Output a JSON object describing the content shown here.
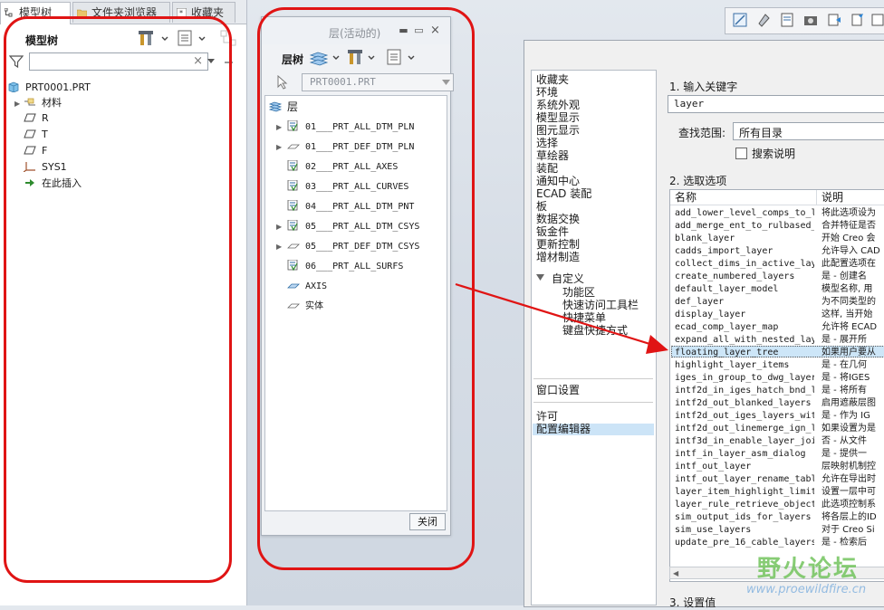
{
  "left_panel": {
    "tabs": [
      "模型树",
      "文件夹浏览器",
      "收藏夹"
    ],
    "title": "模型树",
    "filter_clear": "×",
    "tree": [
      {
        "label": "PRT0001.PRT",
        "icon": "part-icon",
        "level": 0,
        "expander": ""
      },
      {
        "label": "材料",
        "icon": "material-icon",
        "level": 1,
        "expander": "▶"
      },
      {
        "label": "R",
        "icon": "datum-plane-icon",
        "level": 1,
        "expander": ""
      },
      {
        "label": "T",
        "icon": "datum-plane-icon",
        "level": 1,
        "expander": ""
      },
      {
        "label": "F",
        "icon": "datum-plane-icon",
        "level": 1,
        "expander": ""
      },
      {
        "label": "SYS1",
        "icon": "csys-icon",
        "level": 1,
        "expander": ""
      },
      {
        "label": "在此插入",
        "icon": "insert-here-arrow-icon",
        "level": 1,
        "expander": ""
      }
    ]
  },
  "layer_window": {
    "title": "层(活动的)",
    "tree_label": "层树",
    "model_select": "PRT0001.PRT",
    "root": "层",
    "layers": [
      {
        "label": "01___PRT_ALL_DTM_PLN",
        "expander": "▶",
        "icon": "layer-rule-icon"
      },
      {
        "label": "01___PRT_DEF_DTM_PLN",
        "expander": "▶",
        "icon": "layer-plane-icon"
      },
      {
        "label": "02___PRT_ALL_AXES",
        "expander": "",
        "icon": "layer-rule-icon"
      },
      {
        "label": "03___PRT_ALL_CURVES",
        "expander": "",
        "icon": "layer-rule-icon"
      },
      {
        "label": "04___PRT_ALL_DTM_PNT",
        "expander": "",
        "icon": "layer-rule-icon"
      },
      {
        "label": "05___PRT_ALL_DTM_CSYS",
        "expander": "▶",
        "icon": "layer-rule-icon"
      },
      {
        "label": "05___PRT_DEF_DTM_CSYS",
        "expander": "▶",
        "icon": "layer-plane-icon"
      },
      {
        "label": "06___PRT_ALL_SURFS",
        "expander": "",
        "icon": "layer-rule-icon"
      },
      {
        "label": "AXIS",
        "expander": "",
        "icon": "layer-plane-blue-icon"
      },
      {
        "label": "实体",
        "expander": "",
        "icon": "layer-plane-icon"
      }
    ],
    "close_label": "关闭"
  },
  "options_dialog": {
    "nav": [
      "收藏夹",
      "环境",
      "系统外观",
      "模型显示",
      "图元显示",
      "选择",
      "草绘器",
      "装配",
      "通知中心",
      "ECAD 装配",
      "板",
      "数据交换",
      "钣金件",
      "更新控制",
      "增材制造"
    ],
    "customize": {
      "label": "自定义",
      "children": [
        "功能区",
        "快速访问工具栏",
        "快捷菜单",
        "键盘快捷方式"
      ]
    },
    "window_settings": "窗口设置",
    "license": "许可",
    "config_editor": "配置编辑器",
    "step1": "1.  输入关键字",
    "keyword": "layer",
    "scope_label": "查找范围:",
    "scope_value": "所有目录",
    "search_desc": "搜索说明",
    "step2": "2.  选取选项",
    "col_name": "名称",
    "col_desc": "说明",
    "options": [
      {
        "name": "add_lower_level_comps_to_l",
        "desc": "将此选项设为"
      },
      {
        "name": "add_merge_ent_to_rulbased_",
        "desc": "合并特征是否"
      },
      {
        "name": "blank_layer",
        "desc": "开始 Creo 会"
      },
      {
        "name": "cadds_import_layer",
        "desc": "允许导入 CAD"
      },
      {
        "name": "collect_dims_in_active_lay",
        "desc": "此配置选项在"
      },
      {
        "name": "create_numbered_layers",
        "desc": "是 - 创建名"
      },
      {
        "name": "default_layer_model",
        "desc": "模型名称, 用"
      },
      {
        "name": "def_layer",
        "desc": "为不同类型的"
      },
      {
        "name": "display_layer",
        "desc": "这样, 当开始"
      },
      {
        "name": "ecad_comp_layer_map",
        "desc": "允许将 ECAD"
      },
      {
        "name": "expand_all_with_nested_lay",
        "desc": "是 - 展开所"
      },
      {
        "name": "floating_layer_tree",
        "desc": "如果用户要从"
      },
      {
        "name": "highlight_layer_items",
        "desc": "是 - 在几何"
      },
      {
        "name": "iges_in_group_to_dwg_layer",
        "desc": "是 - 将IGES"
      },
      {
        "name": "intf2d_in_iges_hatch_bnd_l",
        "desc": "是 - 将所有"
      },
      {
        "name": "intf2d_out_blanked_layers",
        "desc": "启用遮蔽层图"
      },
      {
        "name": "intf2d_out_iges_layers_wit",
        "desc": "是 - 作为 IG"
      },
      {
        "name": "intf2d_out_linemerge_ign_l",
        "desc": "如果设置为是"
      },
      {
        "name": "intf3d_in_enable_layer_joi",
        "desc": "否 - 从文件"
      },
      {
        "name": "intf_in_layer_asm_dialog",
        "desc": "是 - 提供一"
      },
      {
        "name": "intf_out_layer",
        "desc": "层映射机制控"
      },
      {
        "name": "intf_out_layer_rename_tabl",
        "desc": "允许在导出时"
      },
      {
        "name": "layer_item_highlight_limit",
        "desc": "设置一层中可"
      },
      {
        "name": "layer_rule_retrieve_object",
        "desc": "此选项控制系"
      },
      {
        "name": "sim_output_ids_for_layers",
        "desc": "将各层上的ID"
      },
      {
        "name": "sim_use_layers",
        "desc": "对于 Creo Si"
      },
      {
        "name": "update_pre_16_cable_layers",
        "desc": "是 - 检索后"
      }
    ],
    "selected_option": "floating_layer_tree",
    "step3": "3.  设置值"
  },
  "watermark": {
    "text": "野火论坛",
    "url": "www.proewildfire.cn"
  },
  "colors": {
    "annotation_red": "#e01414",
    "selection": "#cde6f8",
    "watermark_green": "#73c45e"
  }
}
